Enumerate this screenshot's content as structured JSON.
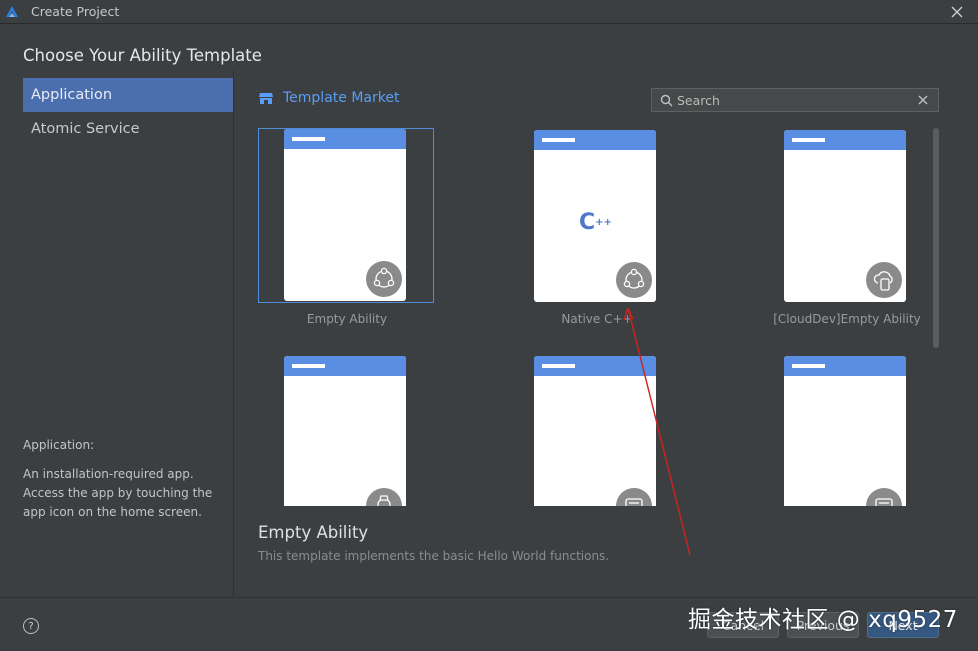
{
  "window": {
    "title": "Create Project"
  },
  "page": {
    "title": "Choose Your Ability Template"
  },
  "sidebar": {
    "items": [
      {
        "label": "Application",
        "active": true
      },
      {
        "label": "Atomic Service",
        "active": false
      }
    ],
    "description": {
      "title": "Application:",
      "text": "An installation-required app. Access the app by touching the app icon on the home screen."
    }
  },
  "market": {
    "label": "Template Market"
  },
  "search": {
    "placeholder": "Search"
  },
  "templates": [
    {
      "label": "Empty Ability",
      "badge": "ability-icon",
      "selected": true
    },
    {
      "label": "Native C++",
      "badge": "ability-icon",
      "logo": "C++"
    },
    {
      "label": "[CloudDev]Empty Ability",
      "badge": "cloud-device-icon"
    },
    {
      "label": "",
      "badge": "watch-icon"
    },
    {
      "label": "",
      "badge": "tablet-icon"
    },
    {
      "label": "",
      "badge": "tablet-icon"
    }
  ],
  "detail": {
    "title": "Empty Ability",
    "description": "This template implements the basic Hello World functions."
  },
  "footer": {
    "cancel_label": "Cancel",
    "previous_label": "Previous",
    "next_label": "Next",
    "help_label": "?"
  },
  "watermark": "掘金技术社区 @ xq9527",
  "colors": {
    "accent": "#4b6eaf",
    "link": "#589df6",
    "phone_header": "#5a8ee3",
    "background": "#3c3f41",
    "annotation_arrow": "#d0221f"
  }
}
